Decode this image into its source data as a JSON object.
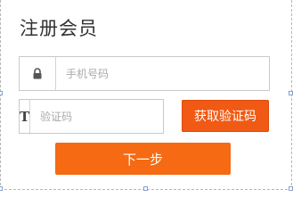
{
  "title": "注册会员",
  "phone_field": {
    "placeholder": "手机号码",
    "icon": "lock-icon"
  },
  "code_field": {
    "placeholder": "验证码",
    "icon_glyph": "T",
    "icon": "text-icon"
  },
  "get_code_button": {
    "label": "获取验证码"
  },
  "next_button": {
    "label": "下一步"
  },
  "colors": {
    "accent": "#f05a14",
    "next": "#f56a12",
    "border": "#c9c9c9"
  }
}
